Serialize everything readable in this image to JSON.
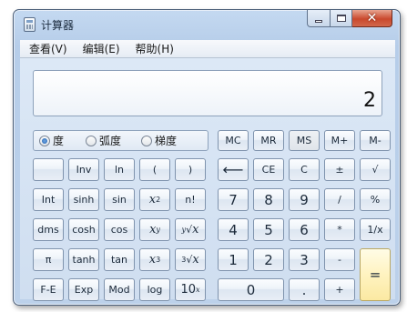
{
  "window": {
    "title": "计算器"
  },
  "menu": [
    "查看(V)",
    "编辑(E)",
    "帮助(H)"
  ],
  "display": {
    "value": "2"
  },
  "angle_modes": [
    {
      "label": "度",
      "selected": true
    },
    {
      "label": "弧度",
      "selected": false
    },
    {
      "label": "梯度",
      "selected": false
    }
  ],
  "memory": [
    "MC",
    "MR",
    "MS",
    "M+",
    "M-"
  ],
  "row1": [
    "",
    "Inv",
    "ln",
    "(",
    ")",
    "⟵",
    "CE",
    "C",
    "±",
    "√"
  ],
  "row2": [
    "Int",
    "sinh",
    "sin",
    "x",
    "n!",
    "7",
    "8",
    "9",
    "/",
    "%"
  ],
  "row3": [
    "dms",
    "cosh",
    "cos",
    "x",
    "x",
    "4",
    "5",
    "6",
    "*",
    "1/x"
  ],
  "row4": [
    "π",
    "tanh",
    "tan",
    "x",
    "x",
    "1",
    "2",
    "3",
    "-"
  ],
  "row5": [
    "F-E",
    "Exp",
    "Mod",
    "log",
    "10",
    "0",
    ".",
    "+"
  ],
  "sup": {
    "x2": "2",
    "xy": "y",
    "rooty": "y",
    "x3": "3",
    "root3": "3",
    "tenx": "x"
  },
  "equals": "=",
  "colors": {
    "titlebar": "#c4d9f1",
    "close": "#c9492d",
    "equals": "#fff3c0"
  }
}
